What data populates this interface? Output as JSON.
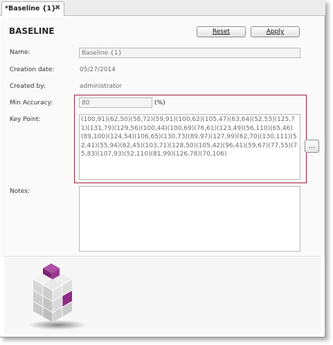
{
  "tab": {
    "label": "*Baseline {1}",
    "close_glyph": "✖"
  },
  "page_title": "BASELINE",
  "buttons": {
    "reset": "Reset",
    "apply": "Apply",
    "more": "..."
  },
  "fields": {
    "name": {
      "label": "Name:",
      "value": "Baseline {1}"
    },
    "creation_date": {
      "label": "Creation date:",
      "value": "05/27/2014"
    },
    "created_by": {
      "label": "Created by:",
      "value": "administrator"
    },
    "min_accuracy": {
      "label": "Min Accuracy:",
      "value": "80",
      "unit": "(%)"
    },
    "key_point": {
      "label": "Key Point:",
      "value": "(100,91)(62,50)(58,72)(59,91)(100,62)(105,47)(63,64)(52,53)(125,71)(131,79)(129,56)(100,44)(100,69)(76,61)(123,49)(56,110)(65,46)(89,100)(124,54)(106,65)(130,73)(89,97)(127,99)(62,70)(130,111)(52,41)(55,94)(62,45)(103,71)(128,50)(105,42)(96,41)(59,67)(77,55)(75,83)(107,93)(52,110)(81,99)(126,78)(70,106)"
    },
    "notes": {
      "label": "Notes:",
      "value": ""
    }
  },
  "colors": {
    "highlight": "#a0203c",
    "logo_accent": "#8e2a86"
  },
  "logo": {
    "icon": "cube-logo-icon"
  }
}
